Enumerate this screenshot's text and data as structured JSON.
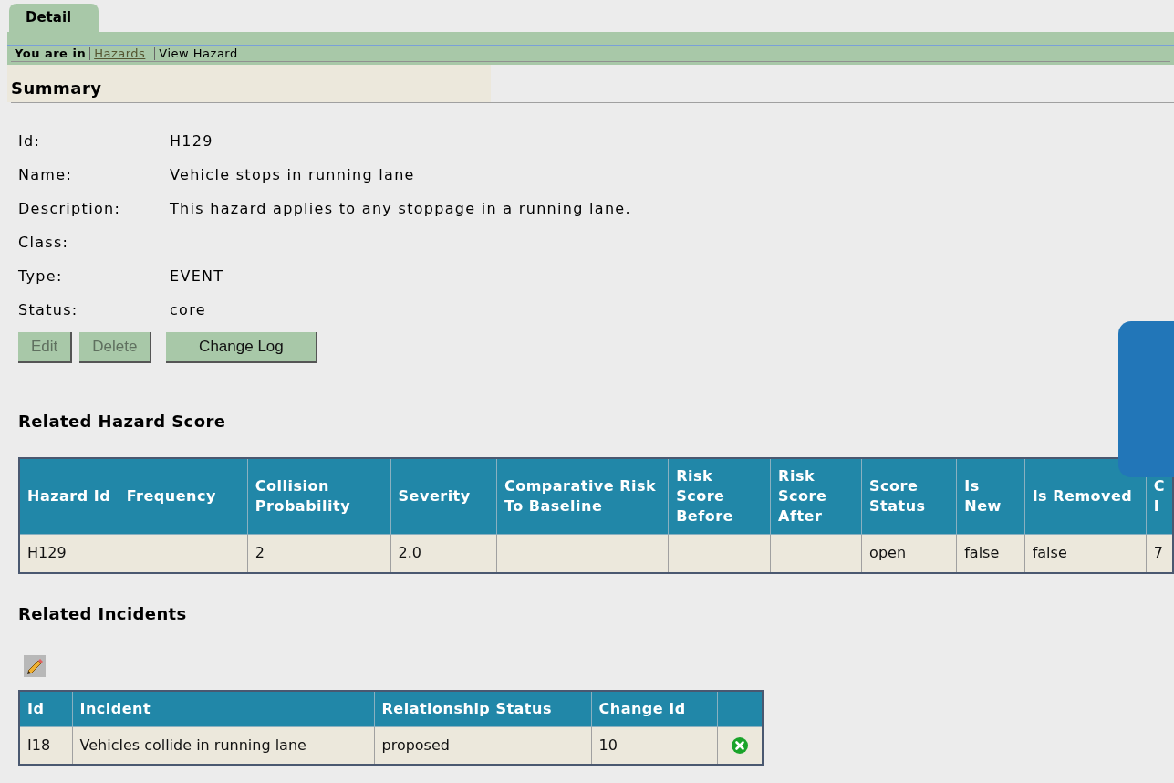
{
  "tabs": [
    {
      "label": "Detail",
      "selected": true
    }
  ],
  "breadcrumb": {
    "prefix": "You are in",
    "items": [
      {
        "label": "Hazards",
        "kind": "link"
      },
      {
        "label": "View Hazard",
        "kind": "current"
      }
    ]
  },
  "summary": {
    "title": "Summary",
    "fields": [
      {
        "label": "Id:",
        "value": "H129"
      },
      {
        "label": "Name:",
        "value": "Vehicle stops in running lane"
      },
      {
        "label": "Description:",
        "value": "This hazard applies to any stoppage in a running lane."
      },
      {
        "label": "Class:"
      },
      {
        "label": "Type:",
        "value": "EVENT"
      },
      {
        "label": "Status:",
        "value": "core"
      }
    ],
    "buttons": [
      {
        "label": "Edit",
        "disabled": true
      },
      {
        "label": "Delete",
        "disabled": true
      },
      {
        "label": "Change Log",
        "disabled": false
      }
    ]
  },
  "score": {
    "title": "Related Hazard Score",
    "columns": [
      "Hazard Id",
      "Frequency",
      "Collision Probability",
      "Severity",
      "Comparative Risk To Baseline",
      "Risk Score Before",
      "Risk Score After",
      "Score Status",
      "Is New",
      "Is Removed",
      "C I"
    ],
    "rows": [
      [
        "H129",
        "",
        "2",
        "2.0",
        "",
        "",
        "",
        "open",
        "false",
        "false",
        "7"
      ]
    ]
  },
  "incidents": {
    "title": "Related Incidents",
    "columns": [
      "Id",
      "Incident",
      "Relationship Status",
      "Change Id"
    ],
    "rows": [
      [
        "I18",
        "Vehicles collide in running lane",
        "proposed",
        "10"
      ]
    ]
  }
}
